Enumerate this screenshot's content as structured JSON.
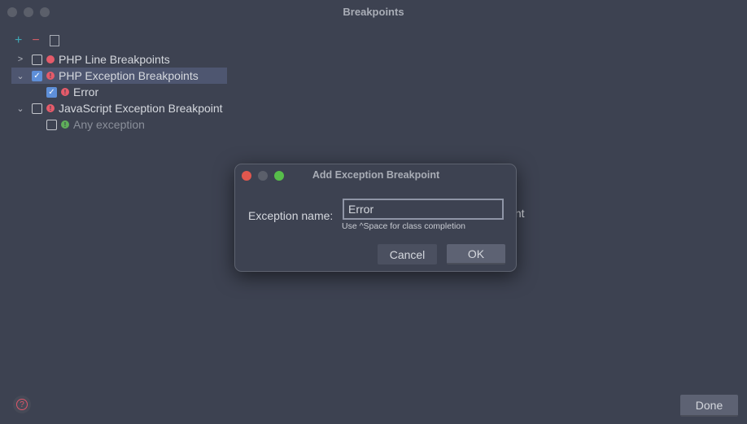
{
  "window": {
    "title": "Breakpoints"
  },
  "toolbar": {
    "add": "+",
    "remove": "−"
  },
  "tree": [
    {
      "label": "PHP Line Breakpoints",
      "checked": false,
      "expanded": false
    },
    {
      "label": "PHP Exception Breakpoints",
      "checked": true,
      "expanded": true,
      "selected": true
    },
    {
      "label": "Error",
      "checked": true
    },
    {
      "label": "JavaScript Exception Breakpoint",
      "checked": false,
      "expanded": true
    },
    {
      "label": "Any exception",
      "checked": false
    }
  ],
  "background_fragment": "oint",
  "dialog": {
    "title": "Add Exception Breakpoint",
    "field_label": "Exception name:",
    "field_value": "Error",
    "hint": "Use ^Space for class completion",
    "cancel": "Cancel",
    "ok": "OK"
  },
  "footer": {
    "help": "?",
    "done": "Done"
  },
  "colors": {
    "background": "#3d4251",
    "selection": "#4e5670",
    "checkbox": "#5e8fd8",
    "breakpoint_red": "#e55b6a",
    "breakpoint_green": "#5fae5a"
  }
}
